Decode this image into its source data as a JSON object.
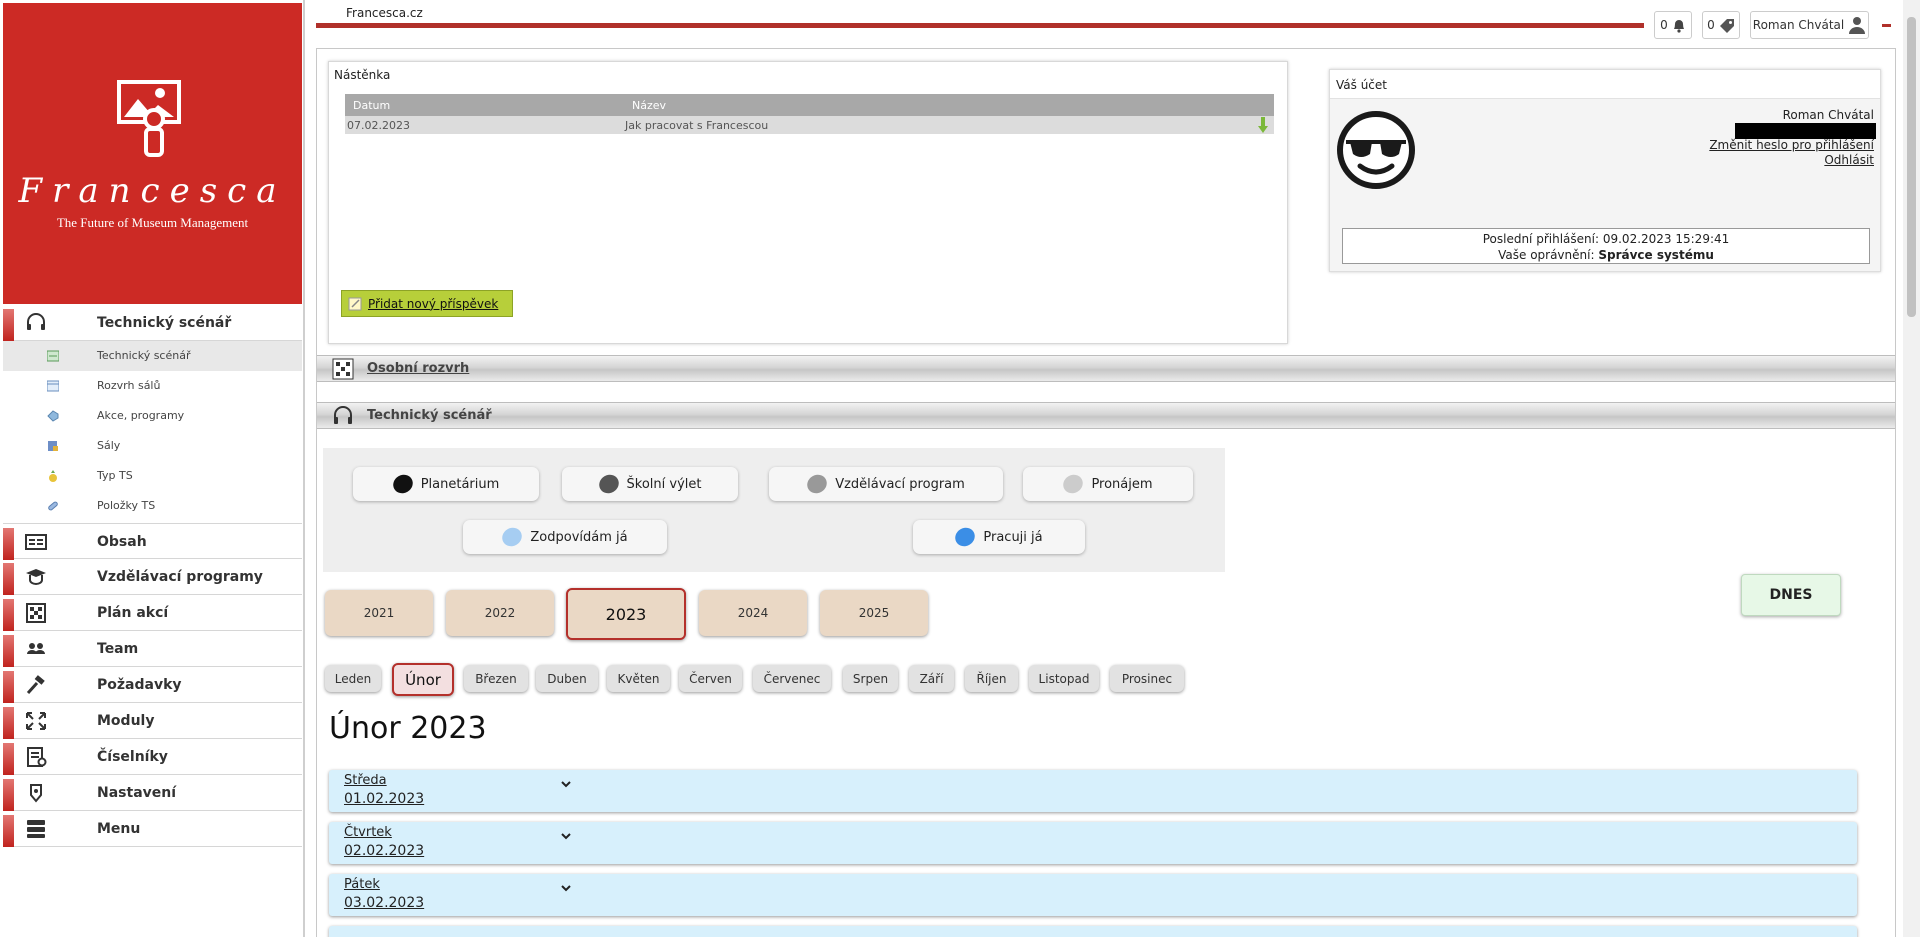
{
  "brand": {
    "name": "Francesca",
    "tagline": "The Future of Museum Management",
    "accent_color": "#cc2a25"
  },
  "sidebar": {
    "sections": [
      {
        "label": "Technický scénář",
        "icon": "headset-icon"
      },
      {
        "label": "Obsah",
        "icon": "content-icon"
      },
      {
        "label": "Vzdělávací programy",
        "icon": "graduation-icon"
      },
      {
        "label": "Plán akcí",
        "icon": "grid-icon"
      },
      {
        "label": "Team",
        "icon": "team-icon"
      },
      {
        "label": "Požadavky",
        "icon": "hammer-icon"
      },
      {
        "label": "Moduly",
        "icon": "expand-icon"
      },
      {
        "label": "Číselníky",
        "icon": "list-icon"
      },
      {
        "label": "Nastavení",
        "icon": "settings-icon"
      },
      {
        "label": "Menu",
        "icon": "menu-stack-icon"
      }
    ],
    "subitems": [
      {
        "label": "Technický scénář",
        "icon": "scenario-icon",
        "active": true
      },
      {
        "label": "Rozvrh sálů",
        "icon": "calendar-icon"
      },
      {
        "label": "Akce, programy",
        "icon": "tag-icon"
      },
      {
        "label": "Sály",
        "icon": "hall-icon"
      },
      {
        "label": "Typ TS",
        "icon": "pineapple-icon"
      },
      {
        "label": "Položky TS",
        "icon": "pill-icon"
      }
    ]
  },
  "topbar": {
    "site_title": "Francesca.cz",
    "notifications_count": "0",
    "tags_count": "0",
    "user_name": "Roman Chvátal"
  },
  "board": {
    "title": "Nástěnka",
    "columns": [
      "Datum",
      "Název"
    ],
    "rows": [
      {
        "date": "07.02.2023",
        "name": "Jak pracovat s Francescou"
      }
    ],
    "add_button": "Přidat nový příspěvek"
  },
  "account": {
    "title": "Váš účet",
    "user_name": "Roman Chvátal",
    "change_password": "Změnit heslo pro přihlášení",
    "logout": "Odhlásit",
    "last_login_label": "Poslední přihlášení:",
    "last_login_value": "09.02.2023 15:29:41",
    "role_label": "Vaše oprávnění:",
    "role_value": "Správce systému"
  },
  "sections": {
    "personal_schedule": "Osobní rozvrh",
    "tech_scenario": "Technický scénář"
  },
  "legend": [
    {
      "label": "Planetárium",
      "color": "#111111"
    },
    {
      "label": "Školní výlet",
      "color": "#555555"
    },
    {
      "label": "Vzdělávací program",
      "color": "#999999"
    },
    {
      "label": "Pronájem",
      "color": "#cccccc"
    },
    {
      "label": "Zodpovídám já",
      "color": "#a6cdf2"
    },
    {
      "label": "Pracuji já",
      "color": "#3b8ee6"
    }
  ],
  "years": [
    "2021",
    "2022",
    "2023",
    "2024",
    "2025"
  ],
  "selected_year": "2023",
  "today_button": "DNES",
  "months": [
    "Leden",
    "Únor",
    "Březen",
    "Duben",
    "Květen",
    "Červen",
    "Červenec",
    "Srpen",
    "Září",
    "Říjen",
    "Listopad",
    "Prosinec"
  ],
  "selected_month": "Únor",
  "month_title": "Únor 2023",
  "days": [
    {
      "name": "Středa",
      "date": "01.02.2023"
    },
    {
      "name": "Čtvrtek",
      "date": "02.02.2023"
    },
    {
      "name": "Pátek",
      "date": "03.02.2023"
    }
  ]
}
